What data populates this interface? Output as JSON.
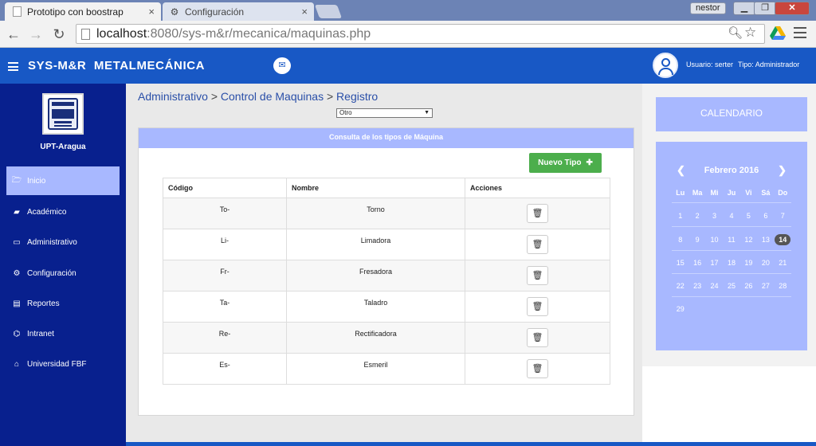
{
  "browser": {
    "tabs": [
      {
        "title": "Prototipo con boostrap",
        "close": "×"
      },
      {
        "title": "Configuración",
        "close": "×"
      }
    ],
    "profile": "nestor",
    "url_host": "localhost",
    "url_path": ":8080/sys-m&r/mecanica/maquinas.php"
  },
  "header": {
    "title": "SYS-M&R  METALMECÁNICA",
    "user_label": "Usuario: serter",
    "role_label": "Tipo: Administrador"
  },
  "sidebar": {
    "campus": "UPT-Aragua",
    "items": [
      {
        "label": "Inicio",
        "icon": "folder-open-icon",
        "glyph": "🗁"
      },
      {
        "label": "Académico",
        "icon": "book-icon",
        "glyph": "▰"
      },
      {
        "label": "Administrativo",
        "icon": "monitor-icon",
        "glyph": "▭"
      },
      {
        "label": "Configuración",
        "icon": "cogs-icon",
        "glyph": "⚙"
      },
      {
        "label": "Reportes",
        "icon": "document-icon",
        "glyph": "▤"
      },
      {
        "label": "Intranet",
        "icon": "sitemap-icon",
        "glyph": "⌬"
      },
      {
        "label": "Universidad FBF",
        "icon": "institution-icon",
        "glyph": "⌂"
      }
    ]
  },
  "breadcrumb": {
    "items": [
      "Administrativo",
      "Control de Maquinas",
      "Registro"
    ],
    "separator": ">"
  },
  "filter": {
    "selected": "Otro"
  },
  "panel": {
    "title": "Consulta de los tipos de Máquina",
    "new_button": "Nuevo Tipo"
  },
  "table": {
    "headers": [
      "Código",
      "Nombre",
      "Acciones"
    ],
    "rows": [
      {
        "code": "To-",
        "name": "Torno"
      },
      {
        "code": "Li-",
        "name": "Limadora"
      },
      {
        "code": "Fr-",
        "name": "Fresadora"
      },
      {
        "code": "Ta-",
        "name": "Taladro"
      },
      {
        "code": "Re-",
        "name": "Rectificadora"
      },
      {
        "code": "Es-",
        "name": "Esmeril"
      }
    ]
  },
  "calendar": {
    "title": "CALENDARIO",
    "month": "Febrero 2016",
    "weekdays": [
      "Lu",
      "Ma",
      "Mi",
      "Ju",
      "Vi",
      "Sá",
      "Do"
    ],
    "weeks": [
      [
        "1",
        "2",
        "3",
        "4",
        "5",
        "6",
        "7"
      ],
      [
        "8",
        "9",
        "10",
        "11",
        "12",
        "13",
        "14"
      ],
      [
        "15",
        "16",
        "17",
        "18",
        "19",
        "20",
        "21"
      ],
      [
        "22",
        "23",
        "24",
        "25",
        "26",
        "27",
        "28"
      ],
      [
        "29",
        "",
        "",
        "",
        "",
        "",
        ""
      ]
    ],
    "today": "14"
  },
  "colors": {
    "header_blue": "#1858c5",
    "sidebar_navy": "#08208e",
    "accent_lavender": "#a8b8ff",
    "success_green": "#4cae4c"
  }
}
